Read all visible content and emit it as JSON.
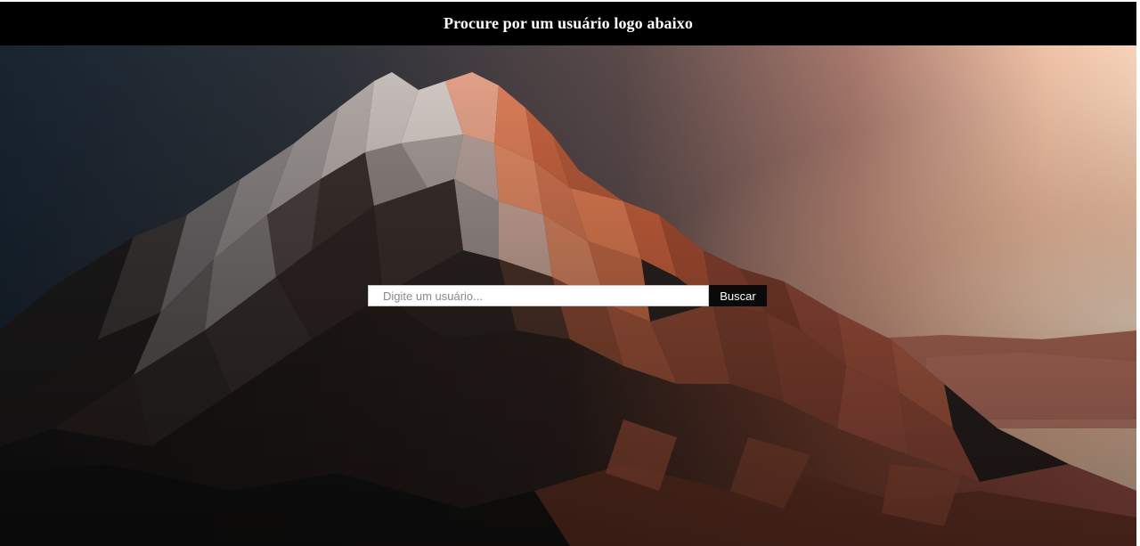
{
  "header": {
    "title": "Procure por um usuário logo abaixo"
  },
  "search": {
    "placeholder": "Digite um usuário...",
    "value": "",
    "button_label": "Buscar"
  },
  "colors": {
    "header_background": "#000000",
    "header_text": "#ffffff",
    "button_background": "#0a0a0a",
    "sky_left": "#1a2733",
    "sky_right": "#f3c7a8",
    "mountain_dark": "#231d1c",
    "mountain_lit": "#c2643f"
  }
}
